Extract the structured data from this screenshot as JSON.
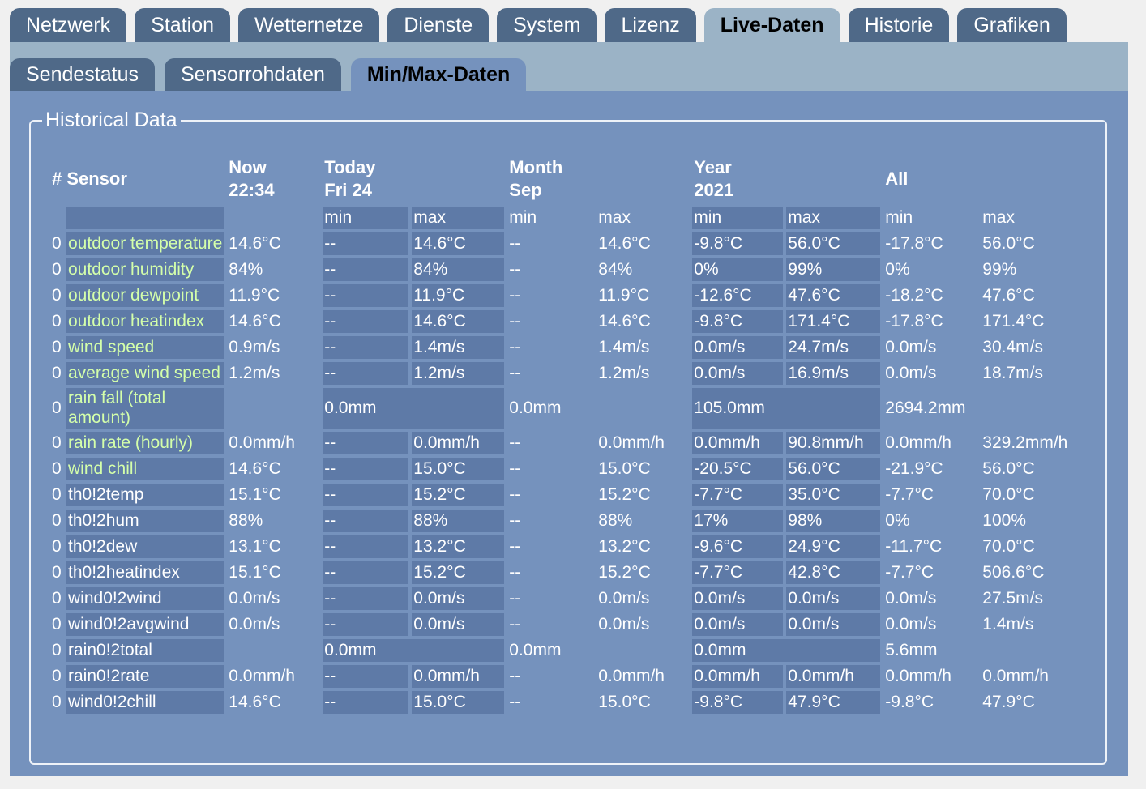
{
  "main_tabs": [
    "Netzwerk",
    "Station",
    "Wetternetze",
    "Dienste",
    "System",
    "Lizenz",
    "Live-Daten",
    "Historie",
    "Grafiken"
  ],
  "main_active": 6,
  "sub_tabs": [
    "Sendestatus",
    "Sensorrohdaten",
    "Min/Max-Daten"
  ],
  "sub_active": 2,
  "fieldset_title": "Historical Data",
  "headers": {
    "sensor": "# Sensor",
    "now": "Now\n22:34",
    "today": "Today\nFri 24",
    "month": "Month\nSep",
    "year": "Year\n2021",
    "all": "All"
  },
  "minmax": {
    "min": "min",
    "max": "max"
  },
  "rows": [
    {
      "ch": "0",
      "name": "outdoor temperature",
      "now": "14.6°C",
      "t_min": "--",
      "t_max": "14.6°C",
      "m_min": "--",
      "m_max": "14.6°C",
      "y_min": "-9.8°C",
      "y_max": "56.0°C",
      "a_min": "-17.8°C",
      "a_max": "56.0°C"
    },
    {
      "ch": "0",
      "name": "outdoor humidity",
      "now": "84%",
      "t_min": "--",
      "t_max": "84%",
      "m_min": "--",
      "m_max": "84%",
      "y_min": "0%",
      "y_max": "99%",
      "a_min": "0%",
      "a_max": "99%"
    },
    {
      "ch": "0",
      "name": "outdoor dewpoint",
      "now": "11.9°C",
      "t_min": "--",
      "t_max": "11.9°C",
      "m_min": "--",
      "m_max": "11.9°C",
      "y_min": "-12.6°C",
      "y_max": "47.6°C",
      "a_min": "-18.2°C",
      "a_max": "47.6°C"
    },
    {
      "ch": "0",
      "name": "outdoor heatindex",
      "now": "14.6°C",
      "t_min": "--",
      "t_max": "14.6°C",
      "m_min": "--",
      "m_max": "14.6°C",
      "y_min": "-9.8°C",
      "y_max": "171.4°C",
      "a_min": "-17.8°C",
      "a_max": "171.4°C"
    },
    {
      "ch": "0",
      "name": "wind speed",
      "now": "0.9m/s",
      "t_min": "--",
      "t_max": "1.4m/s",
      "m_min": "--",
      "m_max": "1.4m/s",
      "y_min": "0.0m/s",
      "y_max": "24.7m/s",
      "a_min": "0.0m/s",
      "a_max": "30.4m/s"
    },
    {
      "ch": "0",
      "name": "average wind speed",
      "now": "1.2m/s",
      "t_min": "--",
      "t_max": "1.2m/s",
      "m_min": "--",
      "m_max": "1.2m/s",
      "y_min": "0.0m/s",
      "y_max": "16.9m/s",
      "a_min": "0.0m/s",
      "a_max": "18.7m/s"
    },
    {
      "ch": "0",
      "name": "rain fall (total amount)",
      "total": true,
      "today": "0.0mm",
      "month": "0.0mm",
      "year": "105.0mm",
      "all": "2694.2mm"
    },
    {
      "ch": "0",
      "name": "rain rate (hourly)",
      "now": "0.0mm/h",
      "t_min": "--",
      "t_max": "0.0mm/h",
      "m_min": "--",
      "m_max": "0.0mm/h",
      "y_min": "0.0mm/h",
      "y_max": "90.8mm/h",
      "a_min": "0.0mm/h",
      "a_max": "329.2mm/h"
    },
    {
      "ch": "0",
      "name": "wind chill",
      "now": "14.6°C",
      "t_min": "--",
      "t_max": "15.0°C",
      "m_min": "--",
      "m_max": "15.0°C",
      "y_min": "-20.5°C",
      "y_max": "56.0°C",
      "a_min": "-21.9°C",
      "a_max": "56.0°C"
    },
    {
      "ch": "0",
      "name": "th0!2temp",
      "plain": true,
      "now": "15.1°C",
      "t_min": "--",
      "t_max": "15.2°C",
      "m_min": "--",
      "m_max": "15.2°C",
      "y_min": "-7.7°C",
      "y_max": "35.0°C",
      "a_min": "-7.7°C",
      "a_max": "70.0°C"
    },
    {
      "ch": "0",
      "name": "th0!2hum",
      "plain": true,
      "now": "88%",
      "t_min": "--",
      "t_max": "88%",
      "m_min": "--",
      "m_max": "88%",
      "y_min": "17%",
      "y_max": "98%",
      "a_min": "0%",
      "a_max": "100%"
    },
    {
      "ch": "0",
      "name": "th0!2dew",
      "plain": true,
      "now": "13.1°C",
      "t_min": "--",
      "t_max": "13.2°C",
      "m_min": "--",
      "m_max": "13.2°C",
      "y_min": "-9.6°C",
      "y_max": "24.9°C",
      "a_min": "-11.7°C",
      "a_max": "70.0°C"
    },
    {
      "ch": "0",
      "name": "th0!2heatindex",
      "plain": true,
      "now": "15.1°C",
      "t_min": "--",
      "t_max": "15.2°C",
      "m_min": "--",
      "m_max": "15.2°C",
      "y_min": "-7.7°C",
      "y_max": "42.8°C",
      "a_min": "-7.7°C",
      "a_max": "506.6°C"
    },
    {
      "ch": "0",
      "name": "wind0!2wind",
      "plain": true,
      "now": "0.0m/s",
      "t_min": "--",
      "t_max": "0.0m/s",
      "m_min": "--",
      "m_max": "0.0m/s",
      "y_min": "0.0m/s",
      "y_max": "0.0m/s",
      "a_min": "0.0m/s",
      "a_max": "27.5m/s"
    },
    {
      "ch": "0",
      "name": "wind0!2avgwind",
      "plain": true,
      "now": "0.0m/s",
      "t_min": "--",
      "t_max": "0.0m/s",
      "m_min": "--",
      "m_max": "0.0m/s",
      "y_min": "0.0m/s",
      "y_max": "0.0m/s",
      "a_min": "0.0m/s",
      "a_max": "1.4m/s"
    },
    {
      "ch": "0",
      "name": "rain0!2total",
      "plain": true,
      "total": true,
      "today": "0.0mm",
      "month": "0.0mm",
      "year": "0.0mm",
      "all": "5.6mm"
    },
    {
      "ch": "0",
      "name": "rain0!2rate",
      "plain": true,
      "now": "0.0mm/h",
      "t_min": "--",
      "t_max": "0.0mm/h",
      "m_min": "--",
      "m_max": "0.0mm/h",
      "y_min": "0.0mm/h",
      "y_max": "0.0mm/h",
      "a_min": "0.0mm/h",
      "a_max": "0.0mm/h"
    },
    {
      "ch": "0",
      "name": "wind0!2chill",
      "plain": true,
      "now": "14.6°C",
      "t_min": "--",
      "t_max": "15.0°C",
      "m_min": "--",
      "m_max": "15.0°C",
      "y_min": "-9.8°C",
      "y_max": "47.9°C",
      "a_min": "-9.8°C",
      "a_max": "47.9°C"
    }
  ]
}
